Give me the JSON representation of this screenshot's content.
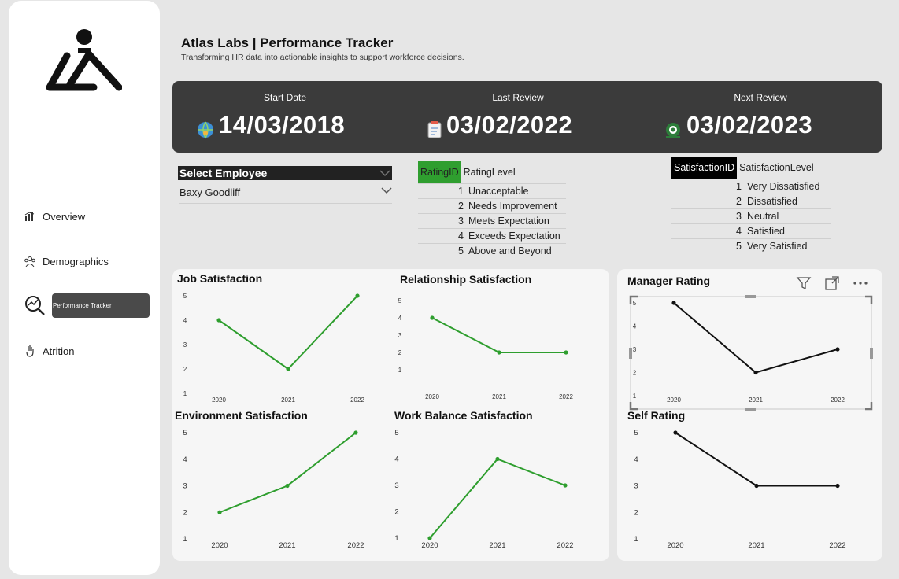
{
  "header": {
    "title": "Atlas Labs | Performance Tracker",
    "subtitle": "Transforming HR data into actionable insights to support workforce decisions."
  },
  "sidebar": {
    "items": [
      {
        "label": "Overview",
        "icon": "bar-chart-icon"
      },
      {
        "label": "Demographics",
        "icon": "people-icon"
      },
      {
        "label": "Performance Tracker",
        "icon": "magnifier-chart-icon",
        "active": true
      },
      {
        "label": "Atrition",
        "icon": "hand-icon"
      }
    ]
  },
  "kpis": [
    {
      "label": "Start Date",
      "value": "14/03/2018",
      "icon": "globe-people-icon"
    },
    {
      "label": "Last Review",
      "value": "03/02/2022",
      "icon": "clipboard-icon"
    },
    {
      "label": "Next Review",
      "value": "03/02/2023",
      "icon": "target-icon"
    }
  ],
  "slicer": {
    "label": "Select Employee",
    "selected": "Baxy Goodliff"
  },
  "rating_table": {
    "headers": [
      "RatingID",
      "RatingLevel"
    ],
    "rows": [
      {
        "id": "1",
        "level": "Unacceptable"
      },
      {
        "id": "2",
        "level": "Needs Improvement"
      },
      {
        "id": "3",
        "level": "Meets Expectation"
      },
      {
        "id": "4",
        "level": "Exceeds Expectation"
      },
      {
        "id": "5",
        "level": "Above and Beyond"
      }
    ],
    "header_color": "#2f9e2f"
  },
  "satisfaction_table": {
    "headers": [
      "SatisfactionID",
      "SatisfactionLevel"
    ],
    "rows": [
      {
        "id": "1",
        "level": "Very Dissatisfied"
      },
      {
        "id": "2",
        "level": "Dissatisfied"
      },
      {
        "id": "3",
        "level": "Neutral"
      },
      {
        "id": "4",
        "level": "Satisfied"
      },
      {
        "id": "5",
        "level": "Very Satisfied"
      }
    ],
    "header_color": "#000000"
  },
  "colors": {
    "green": "#2e9e2e",
    "black": "#111111"
  },
  "chart_data": [
    {
      "type": "line",
      "title": "Job Satisfaction",
      "x": [
        "2020",
        "2021",
        "2022"
      ],
      "values": [
        4,
        2,
        5
      ],
      "ylim": [
        1,
        5
      ],
      "color": "#2e9e2e"
    },
    {
      "type": "line",
      "title": "Relationship Satisfaction",
      "x": [
        "2020",
        "2021",
        "2022"
      ],
      "values": [
        4,
        2,
        2
      ],
      "ylim": [
        1,
        5
      ],
      "color": "#2e9e2e"
    },
    {
      "type": "line",
      "title": "Manager Rating",
      "x": [
        "2020",
        "2021",
        "2022"
      ],
      "values": [
        5,
        2,
        3
      ],
      "ylim": [
        1,
        5
      ],
      "color": "#111111"
    },
    {
      "type": "line",
      "title": "Environment Satisfaction",
      "x": [
        "2020",
        "2021",
        "2022"
      ],
      "values": [
        2,
        3,
        5
      ],
      "ylim": [
        1,
        5
      ],
      "color": "#2e9e2e"
    },
    {
      "type": "line",
      "title": "Work Balance Satisfaction",
      "x": [
        "2020",
        "2021",
        "2022"
      ],
      "values": [
        1,
        4,
        3
      ],
      "ylim": [
        1,
        5
      ],
      "color": "#2e9e2e"
    },
    {
      "type": "line",
      "title": "Self Rating",
      "x": [
        "2020",
        "2021",
        "2022"
      ],
      "values": [
        5,
        3,
        3
      ],
      "ylim": [
        1,
        5
      ],
      "color": "#111111"
    }
  ]
}
